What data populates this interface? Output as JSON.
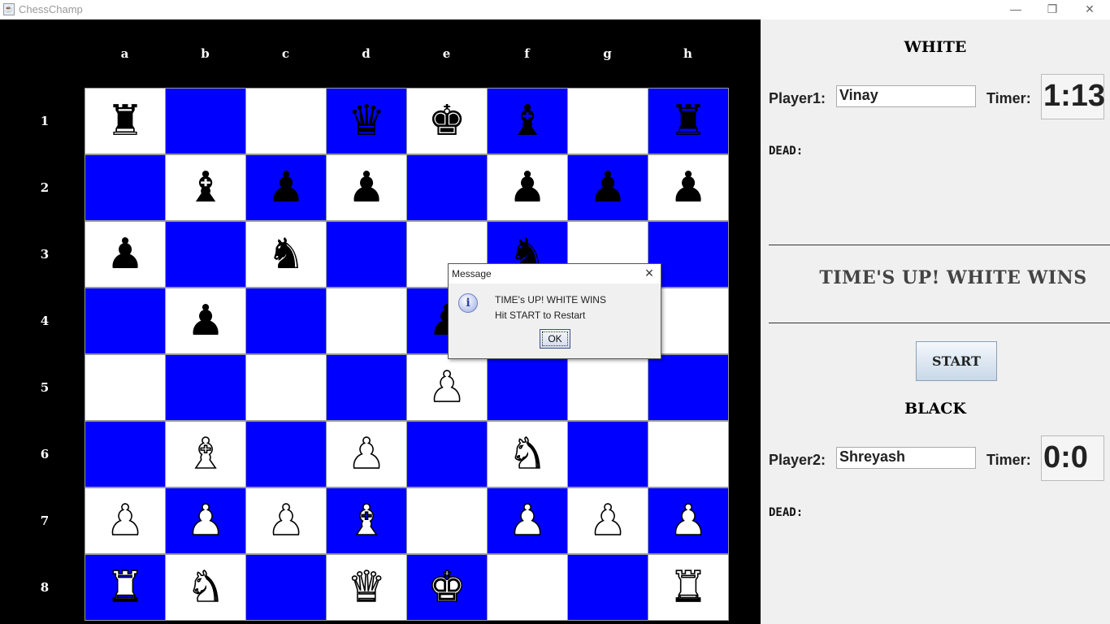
{
  "window": {
    "title": "ChessChamp",
    "controls": {
      "minimize": "—",
      "restore": "❐",
      "close": "✕"
    }
  },
  "board": {
    "files": [
      "a",
      "b",
      "c",
      "d",
      "e",
      "f",
      "g",
      "h"
    ],
    "ranks": [
      "1",
      "2",
      "3",
      "4",
      "5",
      "6",
      "7",
      "8"
    ],
    "light_color": "#ffffff",
    "dark_color": "#0000ff",
    "rows": [
      [
        "r",
        "",
        "",
        "q",
        "k",
        "b",
        "",
        "r"
      ],
      [
        "",
        "b",
        "p",
        "p",
        "",
        "p",
        "p",
        "p"
      ],
      [
        "p",
        "",
        "n",
        "",
        "",
        "n",
        "",
        ""
      ],
      [
        "",
        "p",
        "",
        "",
        "p",
        "",
        "",
        ""
      ],
      [
        "",
        "",
        "",
        "",
        "P",
        "",
        "",
        ""
      ],
      [
        "",
        "B",
        "",
        "P",
        "",
        "N",
        "",
        ""
      ],
      [
        "P",
        "P",
        "P",
        "B",
        "",
        "P",
        "P",
        "P"
      ],
      [
        "R",
        "N",
        "",
        "Q",
        "K",
        "",
        "",
        "R"
      ]
    ]
  },
  "white": {
    "heading": "WHITE",
    "player_label": "Player1:",
    "player_name": "Vinay",
    "timer_label": "Timer:",
    "timer_value": "1:13",
    "dead_label": "DEAD:"
  },
  "status": "TIME'S UP! WHITE WINS",
  "start_label": "START",
  "black": {
    "heading": "BLACK",
    "player_label": "Player2:",
    "player_name": "Shreyash",
    "timer_label": "Timer:",
    "timer_value": "0:0",
    "dead_label": "DEAD:"
  },
  "dialog": {
    "title": "Message",
    "line1": "TIME's UP! WHITE WINS",
    "line2": "Hit START to Restart",
    "ok_label": "OK",
    "icon": "info-icon"
  }
}
